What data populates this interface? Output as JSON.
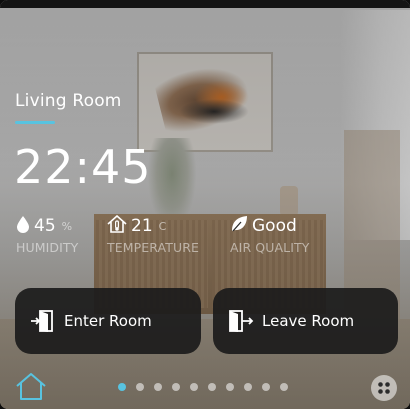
{
  "room": {
    "title": "Living Room"
  },
  "clock": {
    "time": "22:45"
  },
  "stats": {
    "humidity": {
      "value": "45",
      "unit": "%",
      "label": "HUMIDITY",
      "icon": "water-drop-icon"
    },
    "temperature": {
      "value": "21",
      "unit": "C",
      "label": "TEMPERATURE",
      "icon": "thermometer-house-icon"
    },
    "air_quality": {
      "value": "Good",
      "label": "AIR QUALITY",
      "icon": "leaf-icon"
    }
  },
  "actions": {
    "enter": {
      "label": "Enter Room",
      "icon": "door-enter-icon"
    },
    "leave": {
      "label": "Leave Room",
      "icon": "door-exit-icon"
    }
  },
  "pager": {
    "count": 10,
    "active_index": 0
  },
  "colors": {
    "accent": "#58c3e0",
    "button_bg": "#1c1c1c",
    "text": "#ffffff"
  }
}
